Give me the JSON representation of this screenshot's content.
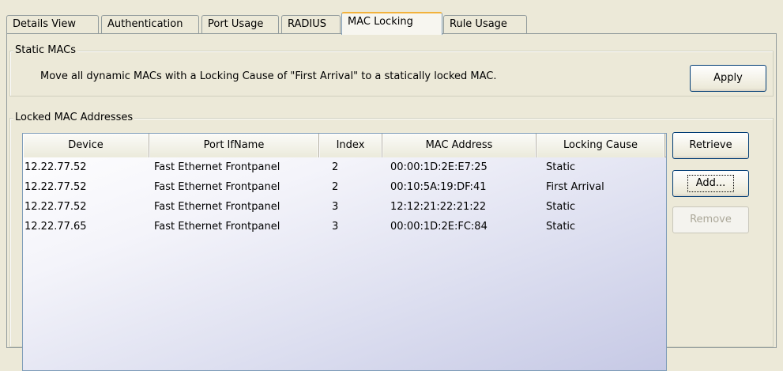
{
  "tabs": [
    {
      "label": "Details View"
    },
    {
      "label": "Authentication"
    },
    {
      "label": "Port Usage"
    },
    {
      "label": "RADIUS"
    },
    {
      "label": "MAC Locking"
    },
    {
      "label": "Rule Usage"
    }
  ],
  "active_tab": "MAC Locking",
  "static_macs": {
    "title": "Static MACs",
    "description": "Move all dynamic MACs with a Locking Cause of \"First Arrival\" to a statically locked MAC.",
    "apply_label": "Apply"
  },
  "locked": {
    "title": "Locked MAC Addresses",
    "columns": [
      "Device",
      "Port IfName",
      "Index",
      "MAC Address",
      "Locking Cause"
    ],
    "rows": [
      [
        "12.22.77.52",
        "Fast Ethernet Frontpanel",
        "2",
        "00:00:1D:2E:E7:25",
        "Static"
      ],
      [
        "12.22.77.52",
        "Fast Ethernet Frontpanel",
        "2",
        "00:10:5A:19:DF:41",
        "First Arrival"
      ],
      [
        "12.22.77.52",
        "Fast Ethernet Frontpanel",
        "3",
        "12:12:21:22:21:22",
        "Static"
      ],
      [
        "12.22.77.65",
        "Fast Ethernet Frontpanel",
        "3",
        "00:00:1D:2E:FC:84",
        "Static"
      ]
    ],
    "retrieve_label": "Retrieve",
    "add_label": "Add...",
    "remove_label": "Remove"
  },
  "colors": {
    "tab_highlight": "#f2b23c",
    "button_border": "#003c74",
    "table_header": "#ebeadb"
  }
}
